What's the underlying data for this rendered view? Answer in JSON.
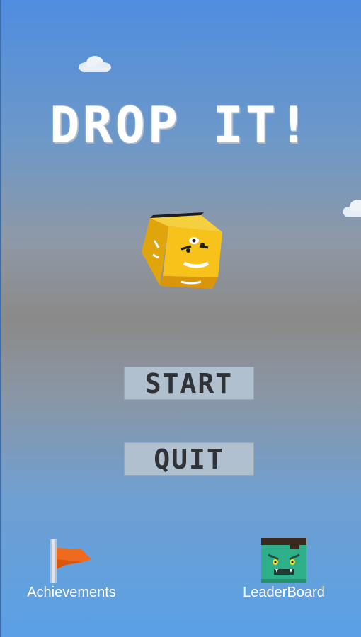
{
  "title": "DROP IT!",
  "menu": {
    "start_label": "START",
    "quit_label": "QUIT"
  },
  "corners": {
    "achievements_label": "Achievements",
    "leaderboard_label": "LeaderBoard"
  },
  "icons": {
    "achievements": "orange-flag-icon",
    "leaderboard": "green-monster-icon",
    "mascot": "yellow-cube-character"
  },
  "colors": {
    "sky_top": "#4f8de0",
    "sky_middle": "#8a8a88",
    "button_bg": "#b0c0cf",
    "button_text": "#2f3338",
    "cube_yellow": "#f7c21a",
    "flag_orange": "#f06a1e",
    "monster_green": "#2fae8a"
  }
}
